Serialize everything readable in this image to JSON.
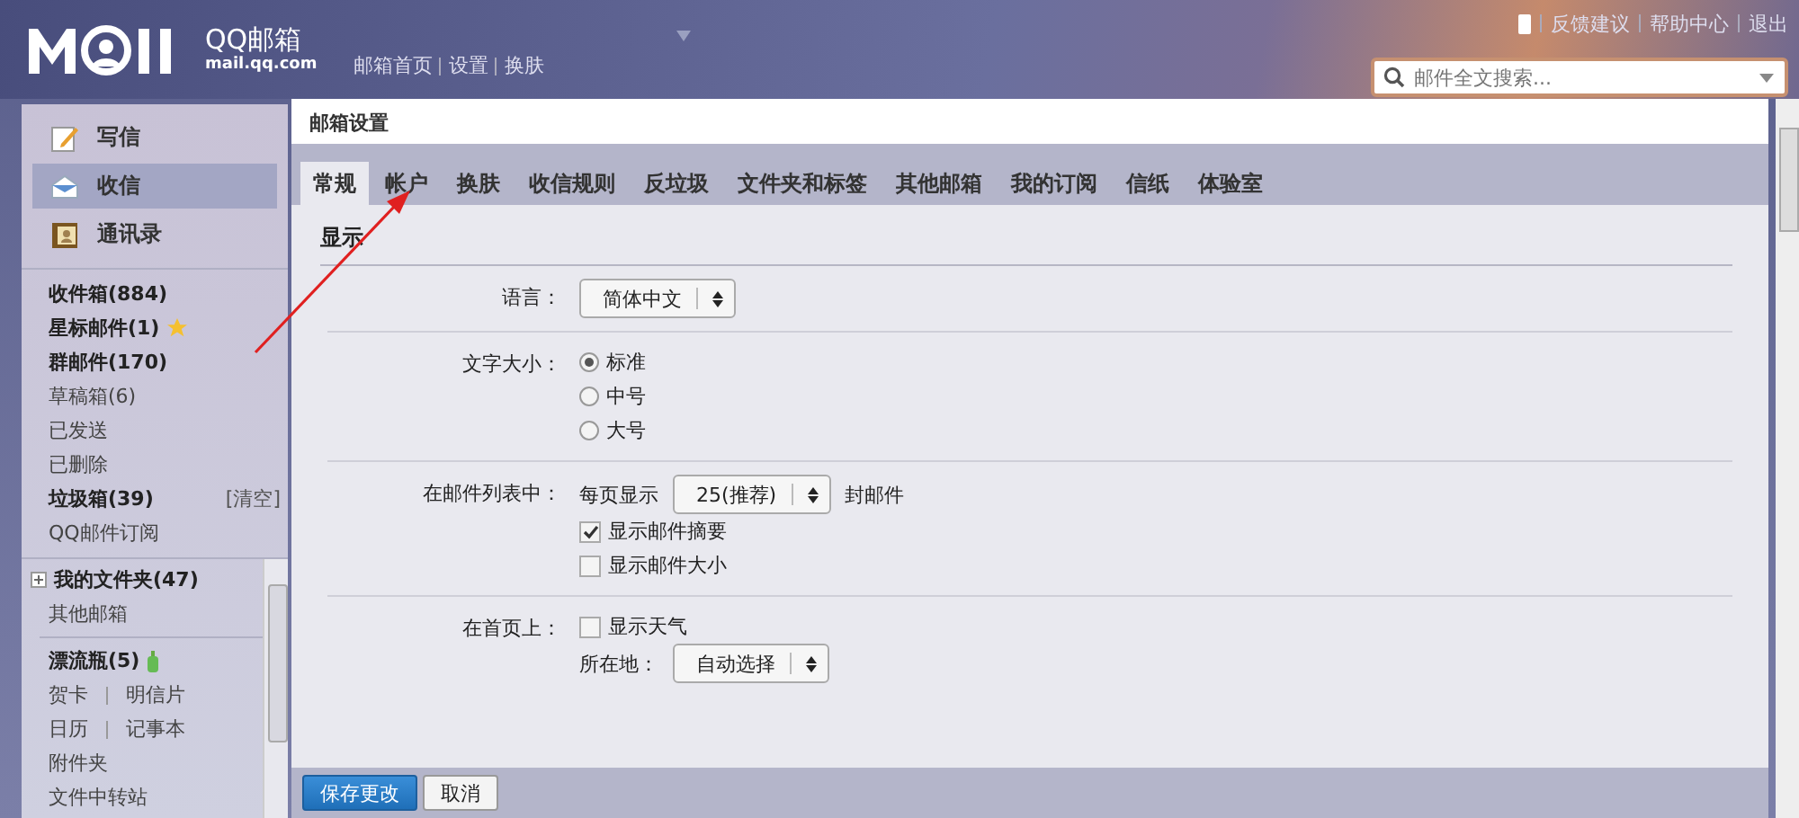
{
  "header": {
    "logo_text": "QQ邮箱",
    "logo_domain": "mail.qq.com",
    "nav_links": [
      "邮箱首页",
      "设置",
      "换肤"
    ],
    "top_links": [
      "反馈建议",
      "帮助中心",
      "退出"
    ],
    "search": {
      "placeholder": "邮件全文搜索..."
    }
  },
  "sidebar": {
    "actions": [
      {
        "label": "写信",
        "kind": "compose",
        "selected": false
      },
      {
        "label": "收信",
        "kind": "inbox",
        "selected": true
      },
      {
        "label": "通讯录",
        "kind": "contacts",
        "selected": false
      }
    ],
    "folders": [
      {
        "label": "收件箱(884)",
        "kind": "folder",
        "unread": true
      },
      {
        "label": "星标邮件(1)",
        "kind": "starred",
        "unread": true
      },
      {
        "label": "群邮件(170)",
        "kind": "folder",
        "unread": true
      },
      {
        "label": "草稿箱(6)",
        "kind": "folder",
        "unread": false
      },
      {
        "label": "已发送",
        "kind": "folder",
        "unread": false
      },
      {
        "label": "已删除",
        "kind": "folder",
        "unread": false
      },
      {
        "label": "垃圾箱(39)",
        "kind": "folder",
        "unread": true,
        "action": "[清空]"
      },
      {
        "label": "QQ邮件订阅",
        "kind": "folder",
        "unread": false
      }
    ],
    "my_folders": {
      "label": "我的文件夹(47)",
      "expanded": false
    },
    "other": [
      {
        "label": "其他邮箱",
        "unread": false
      }
    ],
    "apps": [
      {
        "label": "漂流瓶(5)",
        "kind": "bottle",
        "unread": true
      }
    ],
    "app_pairs": [
      [
        "贺卡",
        "明信片"
      ],
      [
        "日历",
        "记事本"
      ]
    ],
    "tools": [
      "附件夹",
      "文件中转站"
    ]
  },
  "settings": {
    "title": "邮箱设置",
    "tabs": [
      {
        "label": "常规",
        "selected": true
      },
      {
        "label": "帐户",
        "selected": false
      },
      {
        "label": "换肤",
        "selected": false
      },
      {
        "label": "收信规则",
        "selected": false
      },
      {
        "label": "反垃圾",
        "selected": false
      },
      {
        "label": "文件夹和标签",
        "selected": false
      },
      {
        "label": "其他邮箱",
        "selected": false
      },
      {
        "label": "我的订阅",
        "selected": false
      },
      {
        "label": "信纸",
        "selected": false
      },
      {
        "label": "体验室",
        "selected": false
      }
    ],
    "section": "显示",
    "rows": [
      {
        "label": "语言：",
        "lines": [
          [
            {
              "kind": "select",
              "value": "简体中文"
            }
          ]
        ]
      },
      {
        "label": "文字大小：",
        "lines": [
          [
            {
              "kind": "radio",
              "label": "标准",
              "selected": true
            }
          ],
          [
            {
              "kind": "radio",
              "label": "中号",
              "selected": false
            }
          ],
          [
            {
              "kind": "radio",
              "label": "大号",
              "selected": false
            }
          ]
        ]
      },
      {
        "label": "在邮件列表中：",
        "lines": [
          [
            {
              "kind": "text",
              "text": "每页显示"
            },
            {
              "kind": "select",
              "value": "25(推荐)"
            },
            {
              "kind": "text",
              "text": "封邮件"
            }
          ],
          [
            {
              "kind": "checkbox",
              "label": "显示邮件摘要",
              "checked": true
            }
          ],
          [
            {
              "kind": "checkbox",
              "label": "显示邮件大小",
              "checked": false
            }
          ]
        ]
      },
      {
        "label": "在首页上：",
        "lines": [
          [
            {
              "kind": "checkbox",
              "label": "显示天气",
              "checked": false
            }
          ],
          [
            {
              "kind": "text",
              "text": "所在地："
            },
            {
              "kind": "select",
              "value": "自动选择"
            }
          ]
        ]
      }
    ],
    "buttons": [
      {
        "label": "保存更改",
        "kind": "primary"
      },
      {
        "label": "取消",
        "kind": "secondary"
      }
    ]
  }
}
